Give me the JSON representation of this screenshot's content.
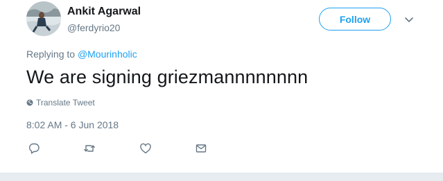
{
  "user": {
    "display_name": "Ankit Agarwal",
    "handle": "@ferdyrio20"
  },
  "follow_label": "Follow",
  "reply_context": {
    "prefix": "Replying to",
    "mention": "@Mourinholic"
  },
  "tweet_text": "We are signing griezmannnnnnnn",
  "translate_label": "Translate Tweet",
  "timestamp": "8:02 AM - 6 Jun 2018",
  "icons": {
    "reply": "reply-icon",
    "retweet": "retweet-icon",
    "like": "heart-icon",
    "dm": "envelope-icon",
    "more": "chevron-down-icon",
    "translate": "globe-icon"
  },
  "colors": {
    "accent": "#1da1f2",
    "text": "#14171a",
    "secondary": "#657786",
    "icon": "#657786"
  }
}
